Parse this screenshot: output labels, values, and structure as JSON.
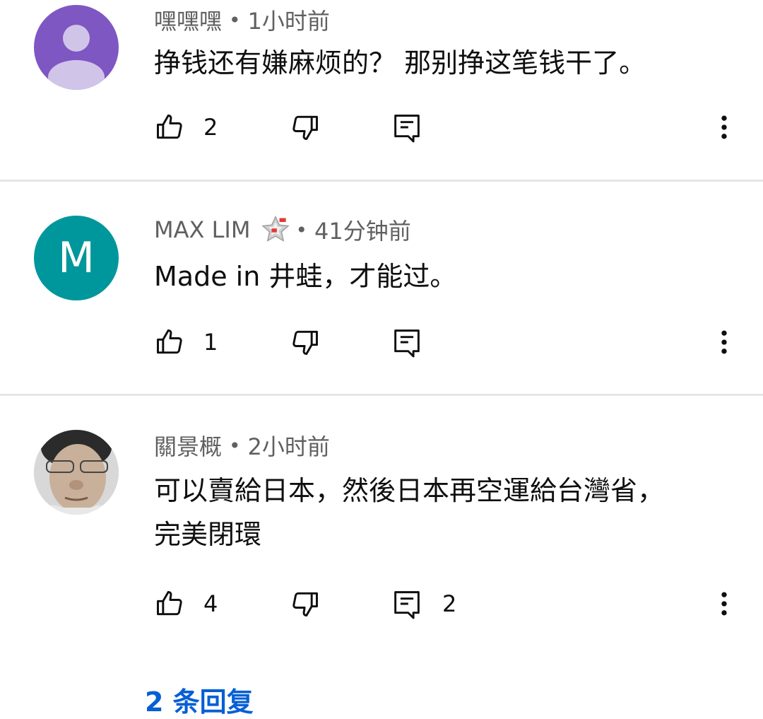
{
  "comments": [
    {
      "author": "嘿嘿嘿",
      "time": "1小时前",
      "text": "挣钱还有嫌麻烦的？ 那别挣这笔钱干了。",
      "likes": "2",
      "replies_count": "",
      "avatar_letter": ""
    },
    {
      "author": "MAX LIM",
      "time": "41分钟前",
      "text": "Made in 井蛙，才能过。",
      "likes": "1",
      "replies_count": "",
      "avatar_letter": "M"
    },
    {
      "author": "關景概",
      "time": "2小时前",
      "text_line1": "可以賣給日本，然後日本再空運給台灣省，",
      "text_line2": "完美閉環",
      "likes": "4",
      "replies_count": "2"
    }
  ],
  "view_replies": "2 条回复",
  "colors": {
    "accent": "#065fd4",
    "meta": "#606060"
  },
  "icons": [
    "like-icon",
    "dislike-icon",
    "reply-icon",
    "more-icon",
    "member-badge-icon"
  ]
}
